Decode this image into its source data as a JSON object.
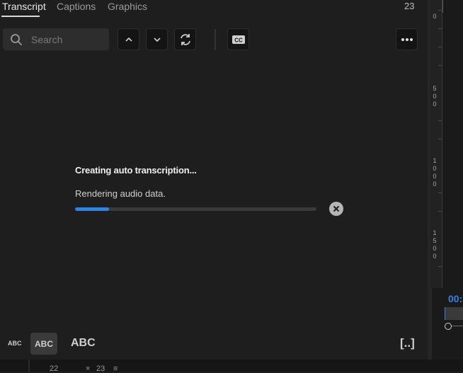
{
  "tabs": [
    {
      "label": "Transcript"
    },
    {
      "label": "Captions"
    },
    {
      "label": "Graphics"
    }
  ],
  "tab_count": "23",
  "search": {
    "placeholder": "Search"
  },
  "toolbar": {
    "up_icon": "chevron-up-icon",
    "down_icon": "chevron-down-icon",
    "refresh_icon": "refresh-icon",
    "cc_label": "CC",
    "more_icon": "more-horizontal-icon"
  },
  "status": {
    "title": "Creating auto transcription...",
    "subtitle": "Rendering audio data.",
    "progress_fraction": 0.14
  },
  "bottom_controls": {
    "abc_small": "ABC",
    "abc_medium": "ABC",
    "abc_large": "ABC",
    "expand_label": "[..]"
  },
  "footer": {
    "left_num": "22",
    "right_num": "23"
  },
  "ruler": {
    "labels": [
      "0",
      "500",
      "1000",
      "1500"
    ]
  },
  "timecode": "00:",
  "colors": {
    "accent": "#2f84e4",
    "background": "#1e1e1e"
  }
}
